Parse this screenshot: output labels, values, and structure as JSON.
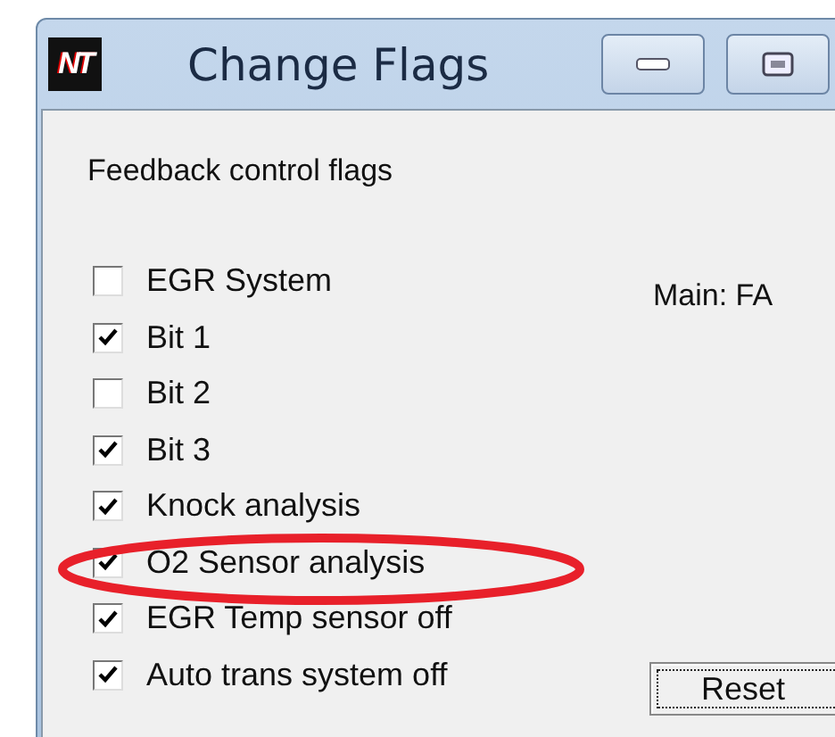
{
  "window": {
    "title": "Change Flags",
    "logo": "NT"
  },
  "group_label": "Feedback control flags",
  "flags": [
    {
      "label": "EGR System",
      "checked": false
    },
    {
      "label": "Bit 1",
      "checked": true
    },
    {
      "label": "Bit 2",
      "checked": false
    },
    {
      "label": "Bit 3",
      "checked": true
    },
    {
      "label": "Knock analysis",
      "checked": true
    },
    {
      "label": "O2 Sensor analysis",
      "checked": true
    },
    {
      "label": "EGR Temp sensor off",
      "checked": true
    },
    {
      "label": "Auto trans system off",
      "checked": true
    }
  ],
  "main_value": "Main: FA",
  "buttons": [
    "Reset"
  ]
}
